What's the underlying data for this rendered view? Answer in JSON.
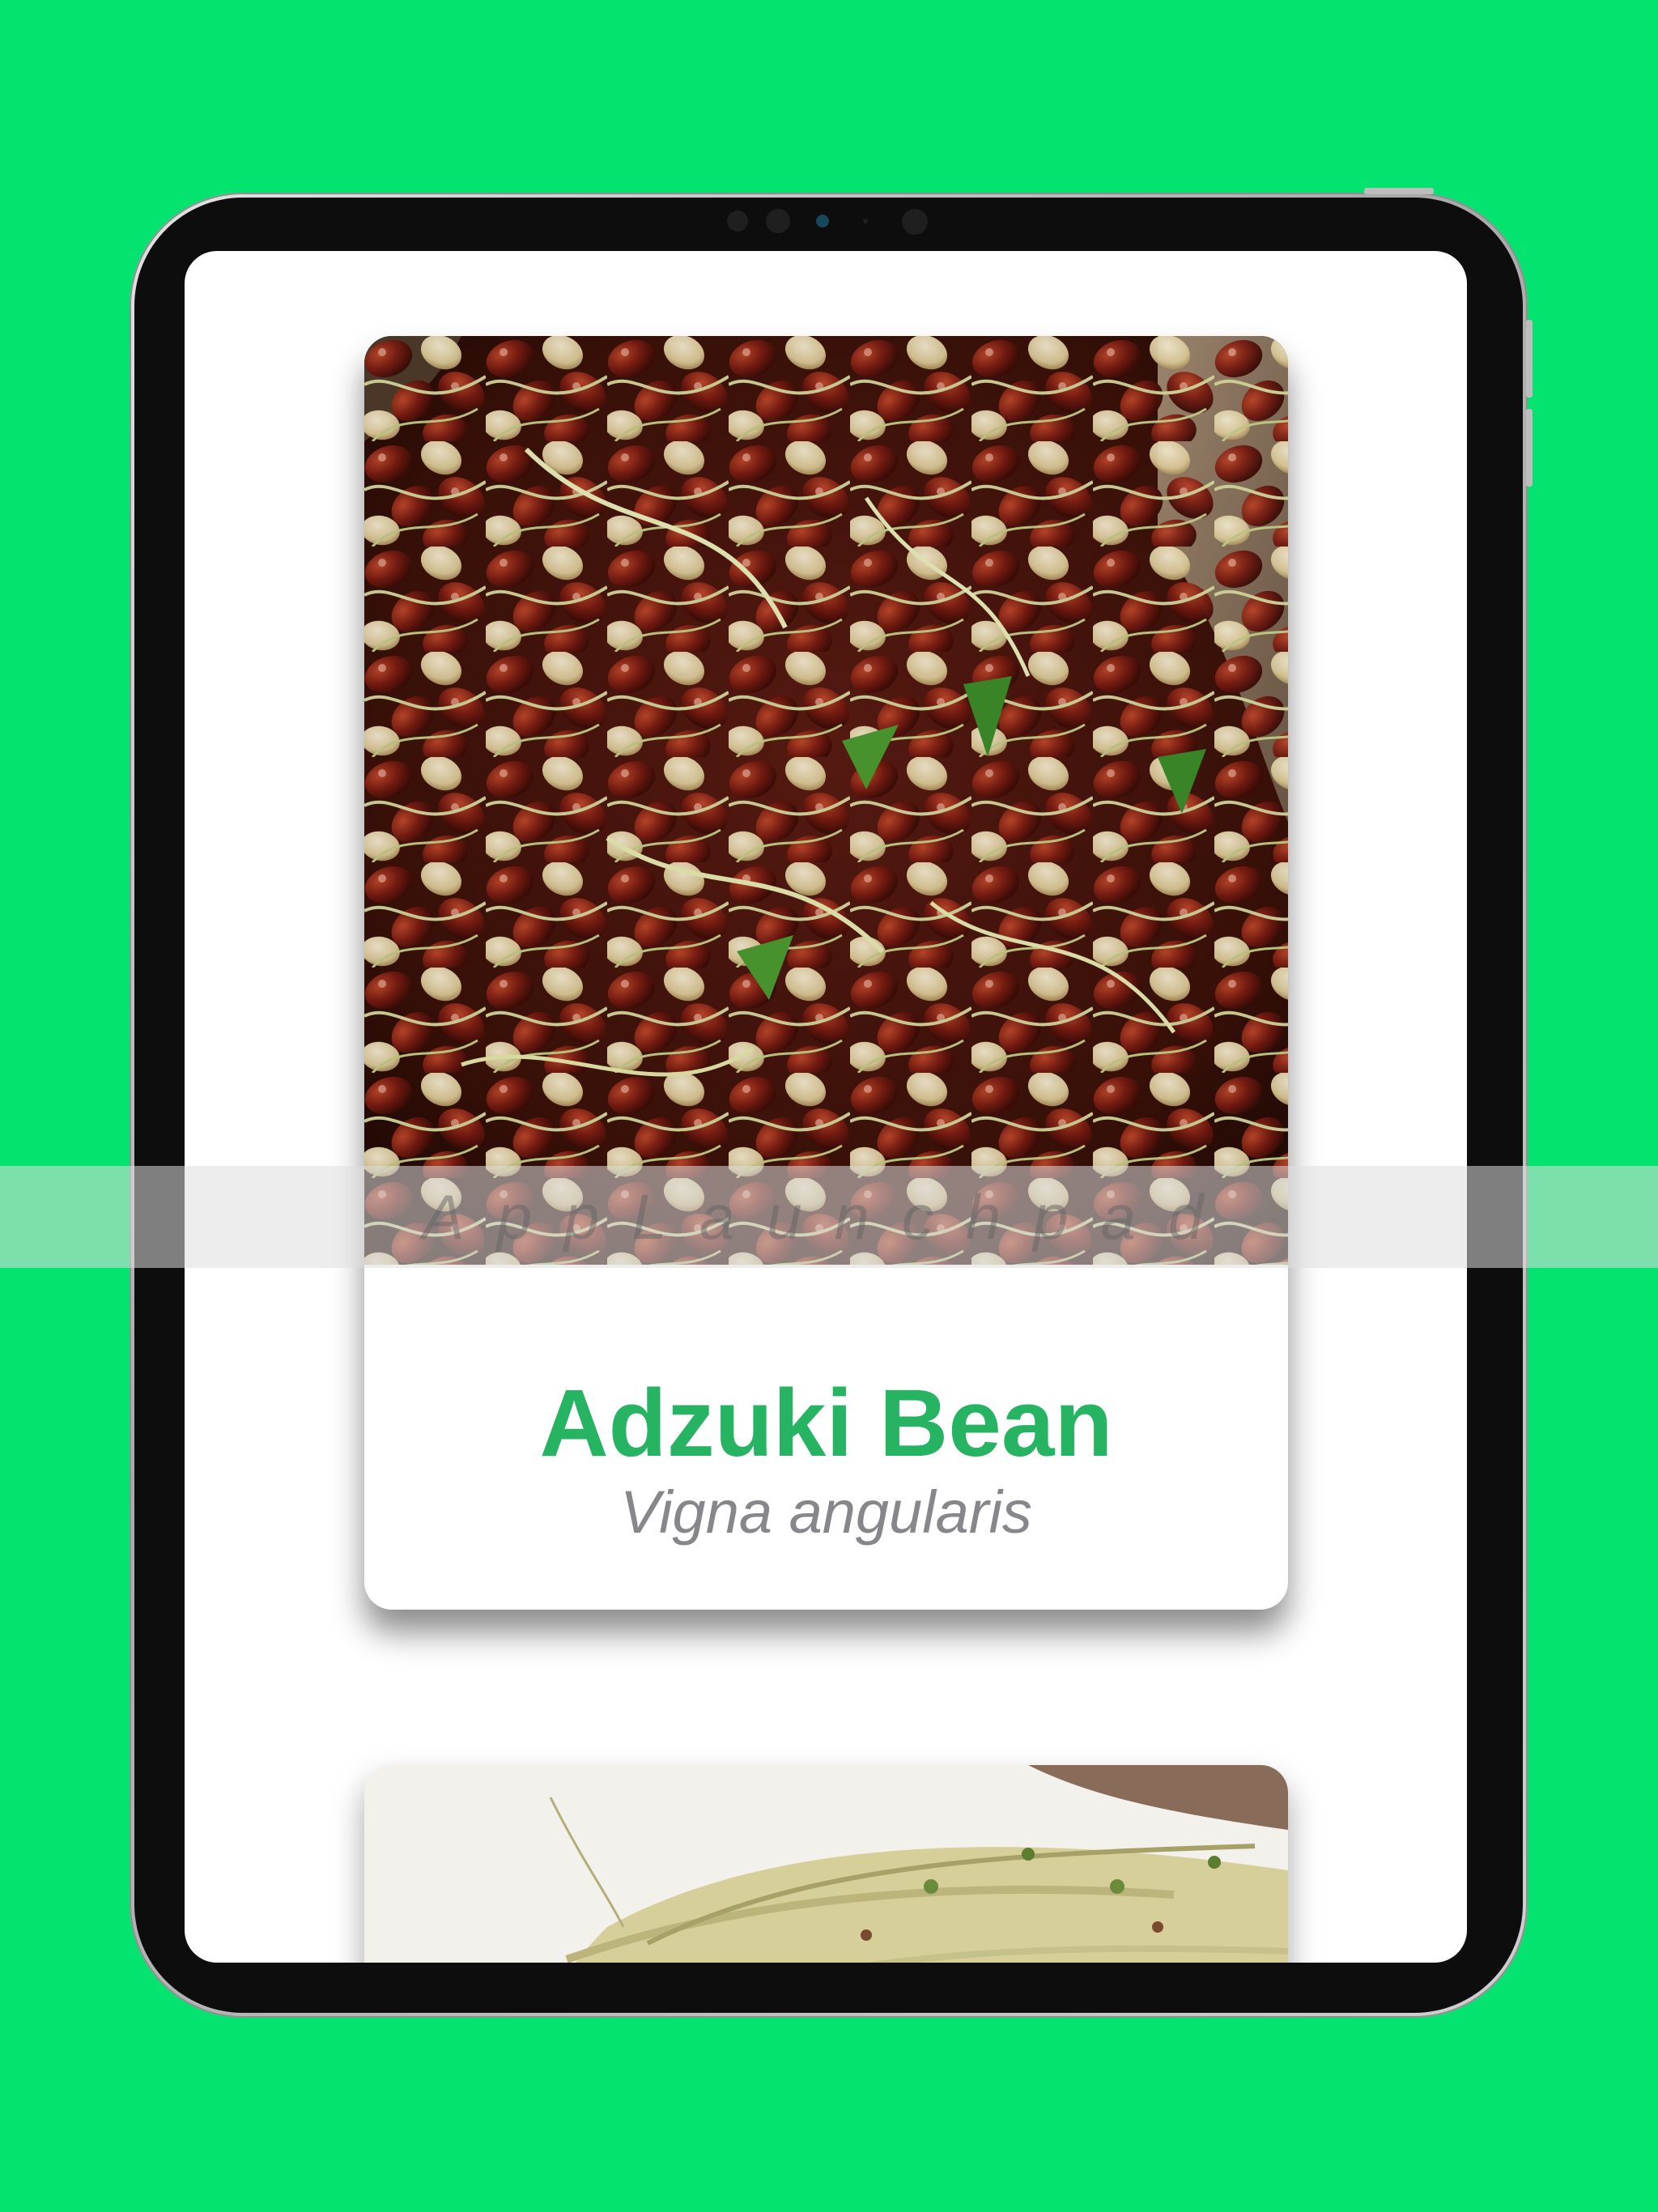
{
  "colors": {
    "background": "#04e370",
    "title": "#26b362",
    "subtitle": "#86868b",
    "card": "#ffffff"
  },
  "cards": [
    {
      "image": "adzuki-bean-sprouts-photo",
      "title": "Adzuki Bean",
      "subtitle": "Vigna angularis"
    },
    {
      "image": "alfalfa-sprouts-photo"
    }
  ],
  "watermark": "AppLaunchpad"
}
